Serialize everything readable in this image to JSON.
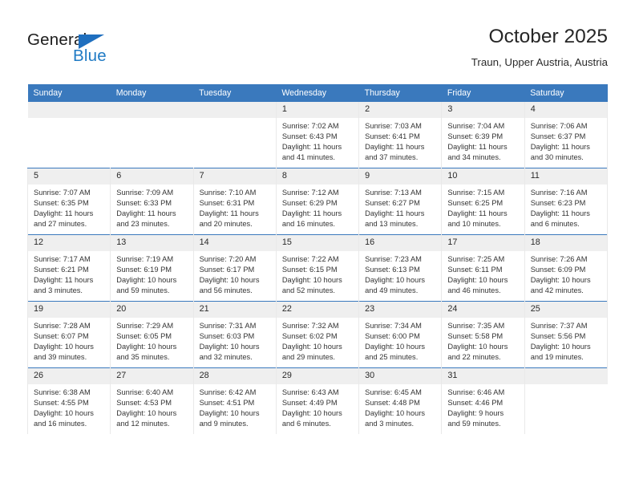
{
  "brand": {
    "name_top": "General",
    "name_bottom": "Blue",
    "triangle_color": "#1f6fbf",
    "blue_color": "#1f7ac4"
  },
  "header": {
    "title": "October 2025",
    "subtitle": "Traun, Upper Austria, Austria",
    "accent_color": "#3a79bd",
    "daynum_band_color": "#efefef"
  },
  "calendar": {
    "weekday_headers": [
      "Sunday",
      "Monday",
      "Tuesday",
      "Wednesday",
      "Thursday",
      "Friday",
      "Saturday"
    ],
    "labels": {
      "sunrise": "Sunrise:",
      "sunset": "Sunset:",
      "daylight": "Daylight:"
    },
    "weeks": [
      [
        {
          "day": "",
          "lines": []
        },
        {
          "day": "",
          "lines": []
        },
        {
          "day": "",
          "lines": []
        },
        {
          "day": "1",
          "lines": [
            "Sunrise: 7:02 AM",
            "Sunset: 6:43 PM",
            "Daylight: 11 hours",
            "and 41 minutes."
          ]
        },
        {
          "day": "2",
          "lines": [
            "Sunrise: 7:03 AM",
            "Sunset: 6:41 PM",
            "Daylight: 11 hours",
            "and 37 minutes."
          ]
        },
        {
          "day": "3",
          "lines": [
            "Sunrise: 7:04 AM",
            "Sunset: 6:39 PM",
            "Daylight: 11 hours",
            "and 34 minutes."
          ]
        },
        {
          "day": "4",
          "lines": [
            "Sunrise: 7:06 AM",
            "Sunset: 6:37 PM",
            "Daylight: 11 hours",
            "and 30 minutes."
          ]
        }
      ],
      [
        {
          "day": "5",
          "lines": [
            "Sunrise: 7:07 AM",
            "Sunset: 6:35 PM",
            "Daylight: 11 hours",
            "and 27 minutes."
          ]
        },
        {
          "day": "6",
          "lines": [
            "Sunrise: 7:09 AM",
            "Sunset: 6:33 PM",
            "Daylight: 11 hours",
            "and 23 minutes."
          ]
        },
        {
          "day": "7",
          "lines": [
            "Sunrise: 7:10 AM",
            "Sunset: 6:31 PM",
            "Daylight: 11 hours",
            "and 20 minutes."
          ]
        },
        {
          "day": "8",
          "lines": [
            "Sunrise: 7:12 AM",
            "Sunset: 6:29 PM",
            "Daylight: 11 hours",
            "and 16 minutes."
          ]
        },
        {
          "day": "9",
          "lines": [
            "Sunrise: 7:13 AM",
            "Sunset: 6:27 PM",
            "Daylight: 11 hours",
            "and 13 minutes."
          ]
        },
        {
          "day": "10",
          "lines": [
            "Sunrise: 7:15 AM",
            "Sunset: 6:25 PM",
            "Daylight: 11 hours",
            "and 10 minutes."
          ]
        },
        {
          "day": "11",
          "lines": [
            "Sunrise: 7:16 AM",
            "Sunset: 6:23 PM",
            "Daylight: 11 hours",
            "and 6 minutes."
          ]
        }
      ],
      [
        {
          "day": "12",
          "lines": [
            "Sunrise: 7:17 AM",
            "Sunset: 6:21 PM",
            "Daylight: 11 hours",
            "and 3 minutes."
          ]
        },
        {
          "day": "13",
          "lines": [
            "Sunrise: 7:19 AM",
            "Sunset: 6:19 PM",
            "Daylight: 10 hours",
            "and 59 minutes."
          ]
        },
        {
          "day": "14",
          "lines": [
            "Sunrise: 7:20 AM",
            "Sunset: 6:17 PM",
            "Daylight: 10 hours",
            "and 56 minutes."
          ]
        },
        {
          "day": "15",
          "lines": [
            "Sunrise: 7:22 AM",
            "Sunset: 6:15 PM",
            "Daylight: 10 hours",
            "and 52 minutes."
          ]
        },
        {
          "day": "16",
          "lines": [
            "Sunrise: 7:23 AM",
            "Sunset: 6:13 PM",
            "Daylight: 10 hours",
            "and 49 minutes."
          ]
        },
        {
          "day": "17",
          "lines": [
            "Sunrise: 7:25 AM",
            "Sunset: 6:11 PM",
            "Daylight: 10 hours",
            "and 46 minutes."
          ]
        },
        {
          "day": "18",
          "lines": [
            "Sunrise: 7:26 AM",
            "Sunset: 6:09 PM",
            "Daylight: 10 hours",
            "and 42 minutes."
          ]
        }
      ],
      [
        {
          "day": "19",
          "lines": [
            "Sunrise: 7:28 AM",
            "Sunset: 6:07 PM",
            "Daylight: 10 hours",
            "and 39 minutes."
          ]
        },
        {
          "day": "20",
          "lines": [
            "Sunrise: 7:29 AM",
            "Sunset: 6:05 PM",
            "Daylight: 10 hours",
            "and 35 minutes."
          ]
        },
        {
          "day": "21",
          "lines": [
            "Sunrise: 7:31 AM",
            "Sunset: 6:03 PM",
            "Daylight: 10 hours",
            "and 32 minutes."
          ]
        },
        {
          "day": "22",
          "lines": [
            "Sunrise: 7:32 AM",
            "Sunset: 6:02 PM",
            "Daylight: 10 hours",
            "and 29 minutes."
          ]
        },
        {
          "day": "23",
          "lines": [
            "Sunrise: 7:34 AM",
            "Sunset: 6:00 PM",
            "Daylight: 10 hours",
            "and 25 minutes."
          ]
        },
        {
          "day": "24",
          "lines": [
            "Sunrise: 7:35 AM",
            "Sunset: 5:58 PM",
            "Daylight: 10 hours",
            "and 22 minutes."
          ]
        },
        {
          "day": "25",
          "lines": [
            "Sunrise: 7:37 AM",
            "Sunset: 5:56 PM",
            "Daylight: 10 hours",
            "and 19 minutes."
          ]
        }
      ],
      [
        {
          "day": "26",
          "lines": [
            "Sunrise: 6:38 AM",
            "Sunset: 4:55 PM",
            "Daylight: 10 hours",
            "and 16 minutes."
          ]
        },
        {
          "day": "27",
          "lines": [
            "Sunrise: 6:40 AM",
            "Sunset: 4:53 PM",
            "Daylight: 10 hours",
            "and 12 minutes."
          ]
        },
        {
          "day": "28",
          "lines": [
            "Sunrise: 6:42 AM",
            "Sunset: 4:51 PM",
            "Daylight: 10 hours",
            "and 9 minutes."
          ]
        },
        {
          "day": "29",
          "lines": [
            "Sunrise: 6:43 AM",
            "Sunset: 4:49 PM",
            "Daylight: 10 hours",
            "and 6 minutes."
          ]
        },
        {
          "day": "30",
          "lines": [
            "Sunrise: 6:45 AM",
            "Sunset: 4:48 PM",
            "Daylight: 10 hours",
            "and 3 minutes."
          ]
        },
        {
          "day": "31",
          "lines": [
            "Sunrise: 6:46 AM",
            "Sunset: 4:46 PM",
            "Daylight: 9 hours",
            "and 59 minutes."
          ]
        },
        {
          "day": "",
          "lines": []
        }
      ]
    ]
  }
}
